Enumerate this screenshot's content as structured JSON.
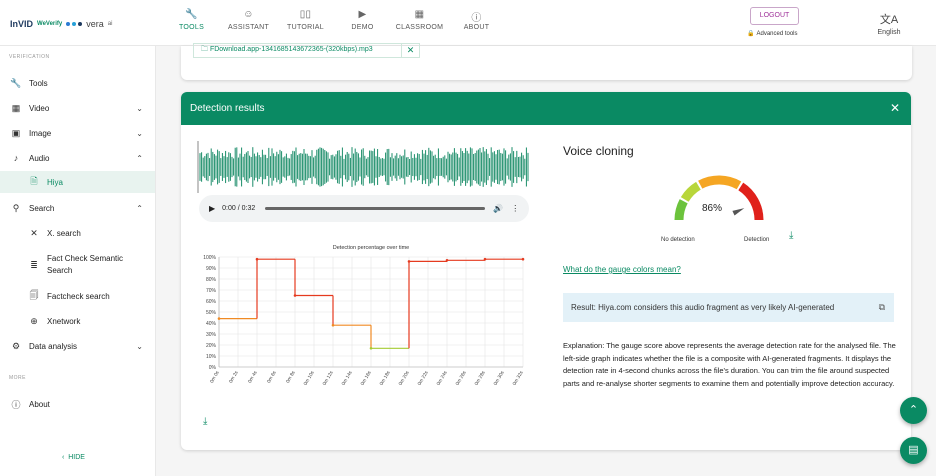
{
  "app": {
    "logo_main": "InVID",
    "logo_sub": "WeVerify",
    "logo_partner": "vera",
    "logo_partner_suffix": "ai",
    "nav": [
      {
        "label": "TOOLS",
        "icon": "wrench-icon",
        "active": true
      },
      {
        "label": "ASSISTANT",
        "icon": "robot-icon",
        "active": false
      },
      {
        "label": "TUTORIAL",
        "icon": "book-icon",
        "active": false
      },
      {
        "label": "DEMO",
        "icon": "video-icon",
        "active": false
      },
      {
        "label": "CLASSROOM",
        "icon": "classroom-icon",
        "active": false
      },
      {
        "label": "ABOUT",
        "icon": "info-icon",
        "active": false
      }
    ],
    "logout_label": "LOGOUT",
    "advanced_label": "Advanced tools",
    "language_label": "English"
  },
  "sidebar": {
    "section_verification": "VERIFICATION",
    "section_more": "MORE",
    "items": [
      {
        "label": "Tools",
        "icon": "wrench-icon"
      },
      {
        "label": "Video",
        "icon": "film-icon",
        "chevron": "down"
      },
      {
        "label": "Image",
        "icon": "image-icon",
        "chevron": "down"
      },
      {
        "label": "Audio",
        "icon": "music-note-icon",
        "chevron": "up"
      },
      {
        "label": "Hiya",
        "icon": "audio-file-icon",
        "selected": true
      },
      {
        "label": "Search",
        "icon": "search-icon",
        "chevron": "up"
      },
      {
        "label": "X. search",
        "icon": "x-logo-icon"
      },
      {
        "label": "Fact Check Semantic Search",
        "icon": "semantic-search-icon"
      },
      {
        "label": "Factcheck search",
        "icon": "document-search-icon"
      },
      {
        "label": "Xnetwork",
        "icon": "network-icon"
      },
      {
        "label": "Data analysis",
        "icon": "data-analysis-icon",
        "chevron": "down"
      },
      {
        "label": "About",
        "icon": "info-icon"
      }
    ],
    "hide_label": "HIDE"
  },
  "file": {
    "name": "FDownload.app-1341685143672365-(320kbps).mp3"
  },
  "results": {
    "title": "Detection results",
    "player_time": "0:00 / 0:32",
    "voice_cloning_title": "Voice cloning",
    "gauge_value": "86%",
    "gauge_fraction": 0.86,
    "gauge_label_low": "No detection",
    "gauge_label_high": "Detection",
    "gauge_link": "What do the gauge colors mean?",
    "result_text": "Result: Hiya.com considers this audio fragment as very likely AI-generated",
    "explanation": "Explanation: The gauge score above represents the average detection rate for the analysed file. The left-side graph indicates whether the file is a composite with AI-generated fragments. It displays the detection rate in 4-second chunks across the file's duration. You can trim the file around suspected parts and re-analyse shorter segments to examine them and potentially improve detection accuracy."
  },
  "chart_data": {
    "type": "line",
    "title": "Detection percentage over time",
    "categories": [
      "0m 0s",
      "0m 2s",
      "0m 4s",
      "0m 6s",
      "0m 8s",
      "0m 10s",
      "0m 12s",
      "0m 14s",
      "0m 16s",
      "0m 18s",
      "0m 20s",
      "0m 22s",
      "0m 24s",
      "0m 26s",
      "0m 28s",
      "0m 30s",
      "0m 32s"
    ],
    "steps": [
      {
        "x0": 0,
        "x1": 4,
        "y": 44,
        "color": "#f08a24"
      },
      {
        "x0": 4,
        "x1": 8,
        "y": 98,
        "color": "#e53a1f"
      },
      {
        "x0": 8,
        "x1": 12,
        "y": 65,
        "color": "#e53a1f"
      },
      {
        "x0": 12,
        "x1": 16,
        "y": 38,
        "color": "#f08a24"
      },
      {
        "x0": 16,
        "x1": 20,
        "y": 17,
        "color": "#a4cc33"
      },
      {
        "x0": 20,
        "x1": 24,
        "y": 96,
        "color": "#e53a1f"
      },
      {
        "x0": 24,
        "x1": 28,
        "y": 97,
        "color": "#e53a1f"
      },
      {
        "x0": 28,
        "x1": 32,
        "y": 98,
        "color": "#e53a1f"
      }
    ],
    "yticks": [
      "0%",
      "10%",
      "20%",
      "30%",
      "40%",
      "50%",
      "60%",
      "70%",
      "80%",
      "90%",
      "100%"
    ],
    "ylim": [
      0,
      100
    ],
    "xlim": [
      0,
      32
    ],
    "grid": true
  }
}
